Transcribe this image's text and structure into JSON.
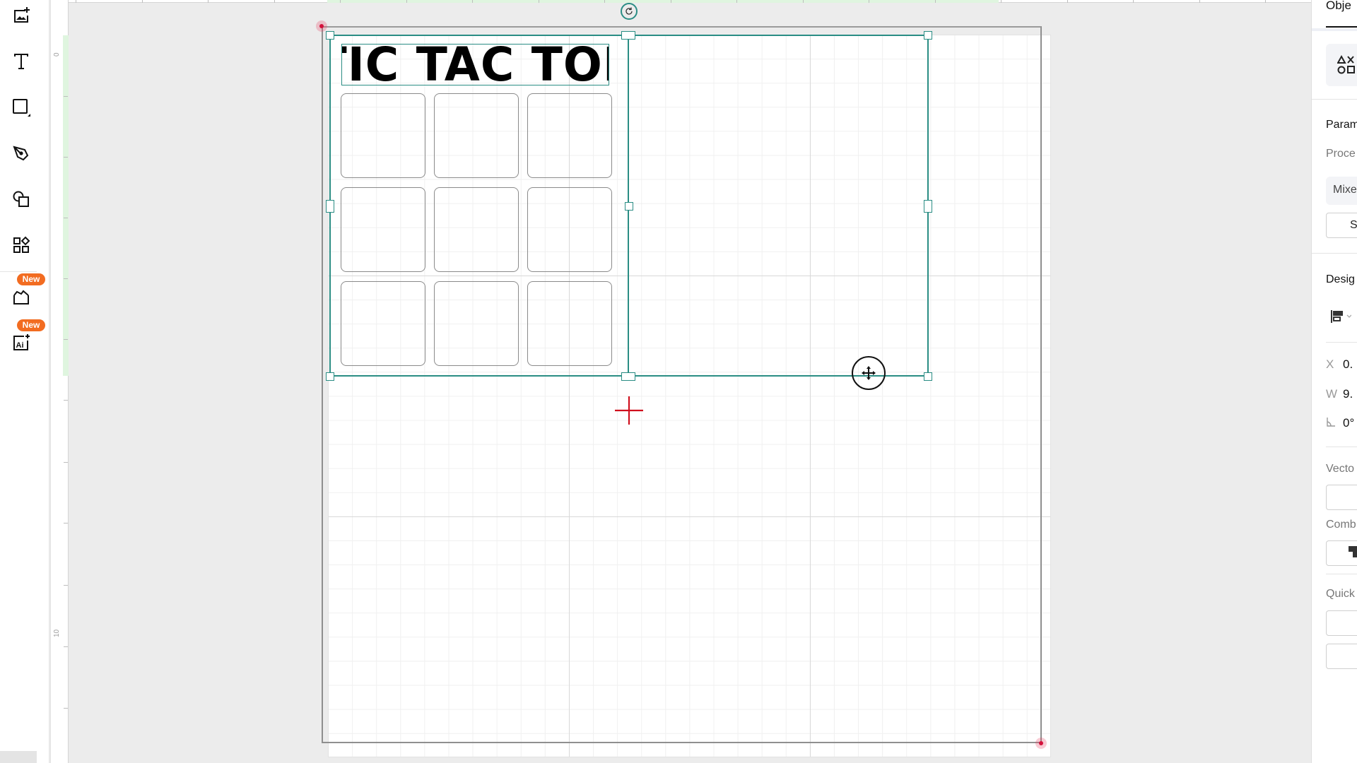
{
  "app": {
    "accent_color": "#2a8d84",
    "badge_color": "#f26c21",
    "registration_mark_color": "#d4123c"
  },
  "toolbar": {
    "items": [
      {
        "name": "upload-image",
        "label": "Upload image"
      },
      {
        "name": "text",
        "label": "Text"
      },
      {
        "name": "shapes",
        "label": "Shapes"
      },
      {
        "name": "pen",
        "label": "Pen"
      },
      {
        "name": "combine",
        "label": "Combine"
      },
      {
        "name": "templates",
        "label": "Templates"
      },
      {
        "name": "projects",
        "label": "Projects",
        "badge": "New"
      },
      {
        "name": "ai-generate",
        "label": "AI",
        "badge": "New"
      }
    ]
  },
  "rulers": {
    "vertical_labels": [
      "0",
      "10"
    ]
  },
  "canvas": {
    "title_text": "TIC TAC TOE",
    "grid": {
      "rows": 3,
      "cols": 3
    }
  },
  "right_panel": {
    "tab_label": "Obje",
    "sections": {
      "parameters": "Param",
      "process_label": "Proce",
      "process_value": "Mixe",
      "process_button": "Se",
      "design": "Desig",
      "x_label": "X",
      "x_value": "0.",
      "w_label": "W",
      "w_value": "9.",
      "angle_value": "0°",
      "vector": "Vecto",
      "combine": "Comb",
      "quick": "Quick"
    }
  }
}
